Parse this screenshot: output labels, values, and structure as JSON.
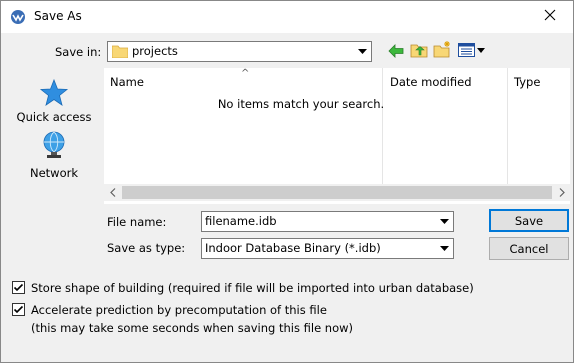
{
  "dialog": {
    "title": "Save As",
    "close_icon": "close-icon",
    "app_icon": "app-icon"
  },
  "save_in": {
    "label": "Save in:",
    "value": "projects"
  },
  "toolbar": {
    "back_icon": "back-arrow-icon",
    "up_icon": "up-folder-icon",
    "new_folder_icon": "new-folder-icon",
    "view_menu_icon": "view-menu-icon"
  },
  "places": [
    {
      "label": "Quick access",
      "icon": "quick-access-star-icon"
    },
    {
      "label": "Network",
      "icon": "network-globe-icon"
    }
  ],
  "list": {
    "columns": [
      "Name",
      "Date modified",
      "Type"
    ],
    "empty_message": "No items match your search."
  },
  "file_name": {
    "label": "File name:",
    "value": "filename.idb"
  },
  "save_as_type": {
    "label": "Save as type:",
    "value": "Indoor Database Binary (*.idb)"
  },
  "buttons": {
    "save": "Save",
    "cancel": "Cancel"
  },
  "options": [
    {
      "label": "Store shape of building (required if file will be imported into urban database)",
      "checked": true
    },
    {
      "label": "Accelerate prediction by precomputation of this file",
      "checked": true
    }
  ],
  "note": "(this may take some seconds when saving this file now)",
  "colors": {
    "window_bg": "#f0f0f0",
    "accent": "#0078d7",
    "folder_yellow": "#f8d775"
  }
}
